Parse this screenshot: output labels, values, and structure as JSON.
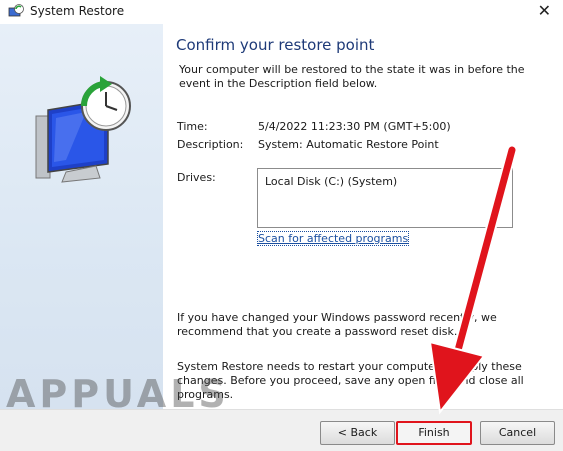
{
  "window": {
    "title": "System Restore"
  },
  "page": {
    "heading": "Confirm your restore point",
    "intro": "Your computer will be restored to the state it was in before the event in the Description field below."
  },
  "details": {
    "time_label": "Time:",
    "time_value": "5/4/2022 11:23:30 PM (GMT+5:00)",
    "description_label": "Description:",
    "description_value": "System: Automatic Restore Point",
    "drives_label": "Drives:",
    "drives": [
      "Local Disk (C:) (System)"
    ]
  },
  "scan_link": "Scan for affected programs",
  "notes": {
    "password": "If you have changed your Windows password recently, we recommend that you create a password reset disk.",
    "restart": "System Restore needs to restart your computer to apply these changes. Before you proceed, save any open files and close all programs."
  },
  "buttons": {
    "back": "< Back",
    "finish": "Finish",
    "cancel": "Cancel"
  },
  "watermark": "APPUALS",
  "colors": {
    "heading": "#1e3a78",
    "annotation_arrow": "#e0141c"
  },
  "icons": {
    "app": "system-restore-icon",
    "close": "close-icon",
    "hero": "monitor-clock-restore-icon"
  }
}
